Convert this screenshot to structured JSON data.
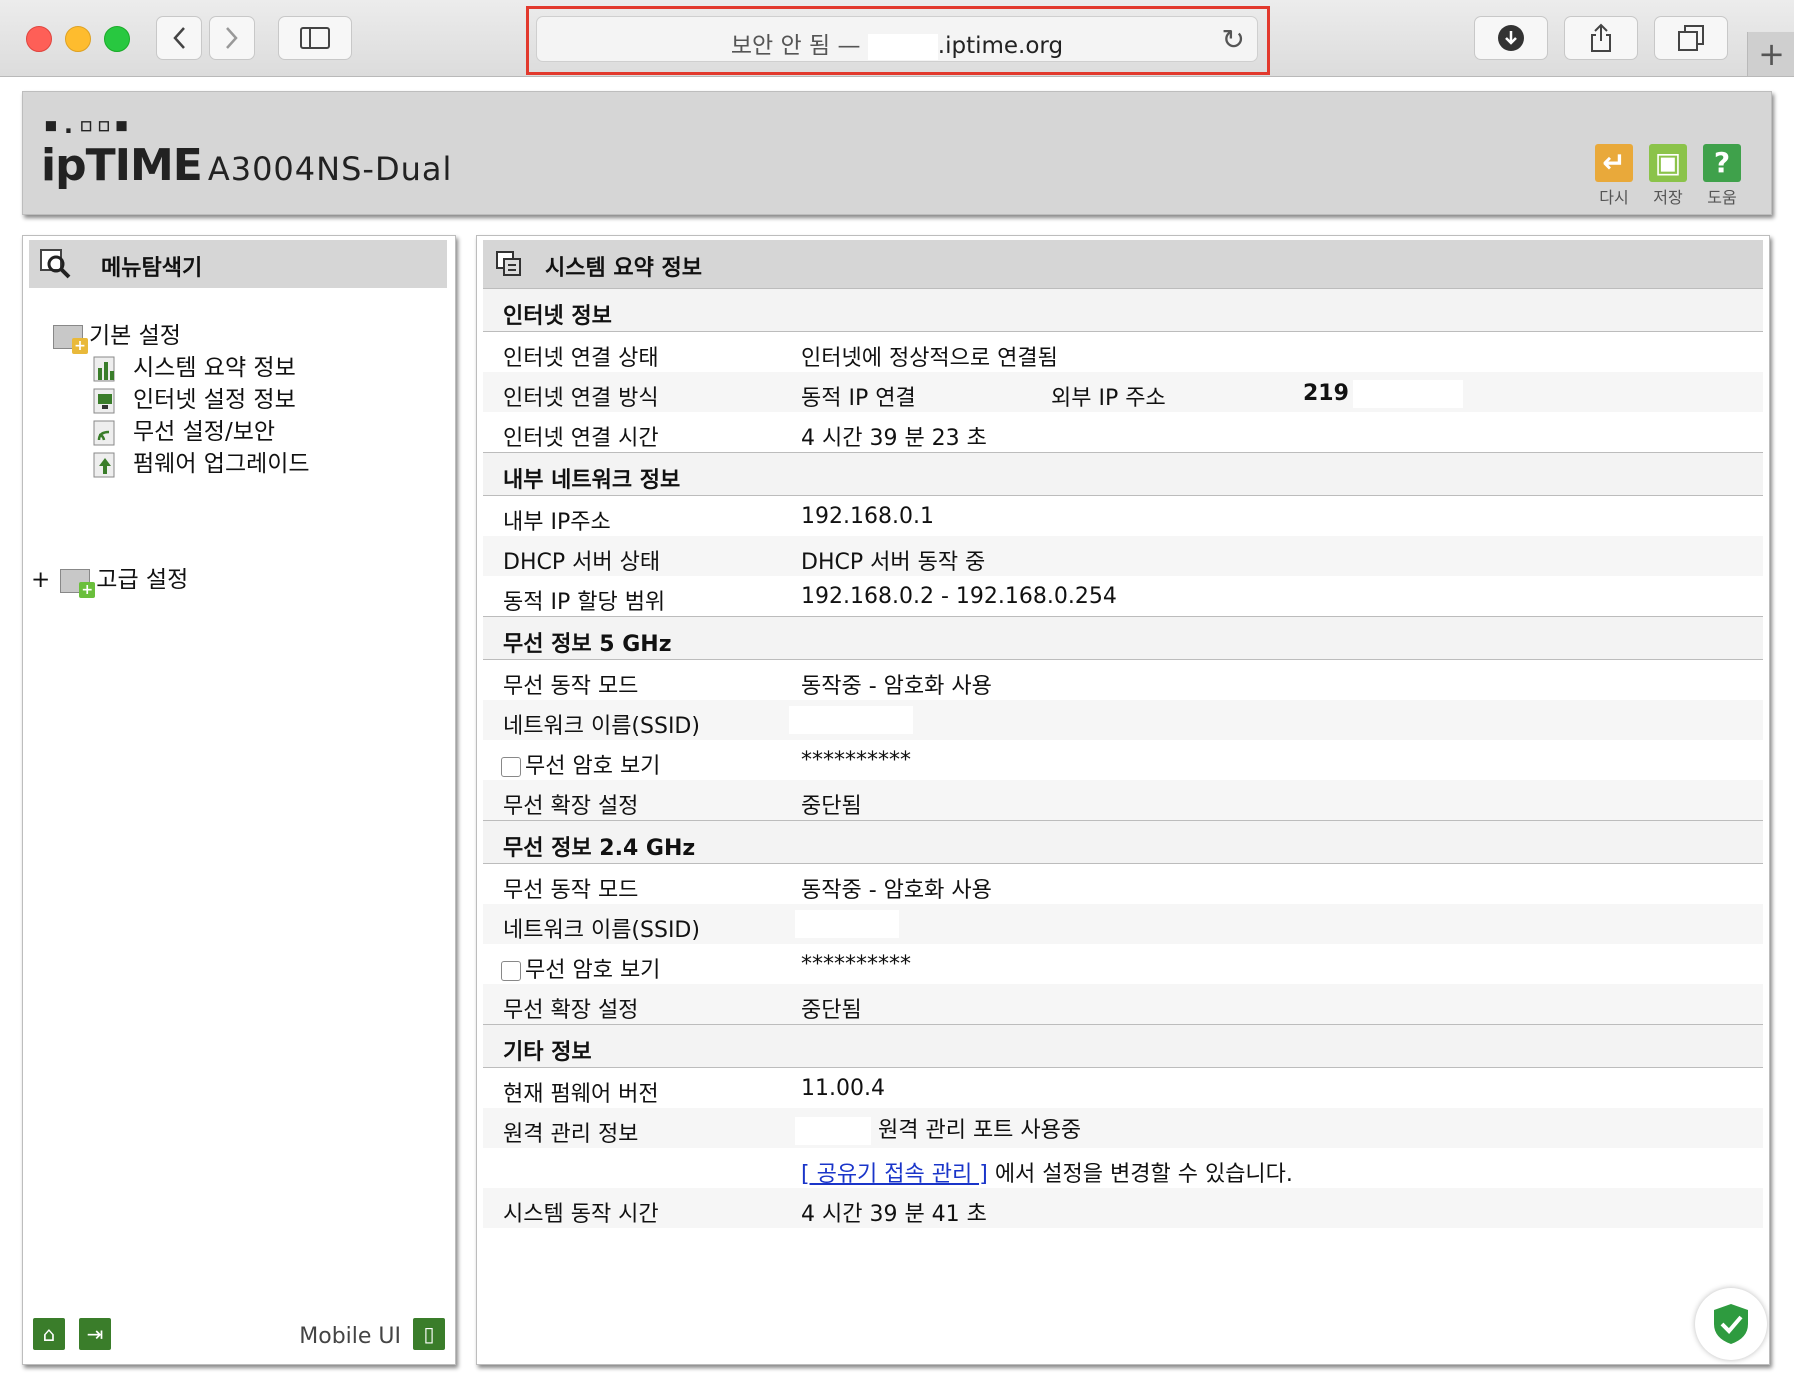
{
  "browser": {
    "address_insecure": "보안 안 됨 —",
    "address_domain": ".iptime.org",
    "back_icon": "chevron-left-icon",
    "forward_icon": "chevron-right-icon"
  },
  "header": {
    "logo_dots": "▪.▫▫▪",
    "logo_brand": "ipTIME",
    "model": "A3004NS-Dual",
    "buttons": [
      {
        "label": "다시",
        "color": "#e9a93a",
        "icon": "undo-icon"
      },
      {
        "label": "저장",
        "color": "#8bc34a",
        "icon": "save-icon"
      },
      {
        "label": "도움",
        "color": "#3fa14b",
        "icon": "help-icon"
      }
    ]
  },
  "sidebar": {
    "title": "메뉴탐색기",
    "basic_label": "기본 설정",
    "items": [
      {
        "label": "시스템 요약 정보"
      },
      {
        "label": "인터넷 설정 정보"
      },
      {
        "label": "무선 설정/보안"
      },
      {
        "label": "펌웨어 업그레이드"
      }
    ],
    "advanced_expand": "+",
    "advanced_label": "고급 설정",
    "mobile_ui": "Mobile UI"
  },
  "main": {
    "title": "시스템 요약 정보",
    "internet": {
      "section": "인터넷 정보",
      "status_k": "인터넷 연결 상태",
      "status_v": "인터넷에 정상적으로 연결됨",
      "method_k": "인터넷 연결 방식",
      "method_v": "동적 IP 연결",
      "ext_ip_k": "외부 IP 주소",
      "ext_ip_v": "219",
      "time_k": "인터넷 연결 시간",
      "time_v": "4 시간 39 분 23 초"
    },
    "lan": {
      "section": "내부 네트워크 정보",
      "ip_k": "내부 IP주소",
      "ip_v": "192.168.0.1",
      "dhcp_k": "DHCP 서버 상태",
      "dhcp_v": "DHCP 서버 동작 중",
      "range_k": "동적 IP 할당 범위",
      "range_v": "192.168.0.2 -  192.168.0.254"
    },
    "wifi5": {
      "section": "무선 정보 5 GHz",
      "mode_k": "무선 동작 모드",
      "mode_v": "동작중 - 암호화 사용",
      "ssid_k": "네트워크 이름(SSID)",
      "pw_k": "무선 암호 보기",
      "pw_v": "**********",
      "ext_k": "무선 확장 설정",
      "ext_v": "중단됨"
    },
    "wifi24": {
      "section": "무선 정보 2.4 GHz",
      "mode_k": "무선 동작 모드",
      "mode_v": "동작중 - 암호화 사용",
      "ssid_k": "네트워크 이름(SSID)",
      "pw_k": "무선 암호 보기",
      "pw_v": "**********",
      "ext_k": "무선 확장 설정",
      "ext_v": "중단됨"
    },
    "etc": {
      "section": "기타 정보",
      "fw_k": "현재 펌웨어 버전",
      "fw_v": "11.00.4",
      "remote_k": "원격 관리 정보",
      "remote_v": "원격 관리 포트 사용중",
      "link_text": "[ 공유기 접속 관리 ]",
      "link_suffix": " 에서 설정을 변경할 수 있습니다.",
      "uptime_k": "시스템 동작 시간",
      "uptime_v": "4 시간 39 분 41 초"
    }
  }
}
